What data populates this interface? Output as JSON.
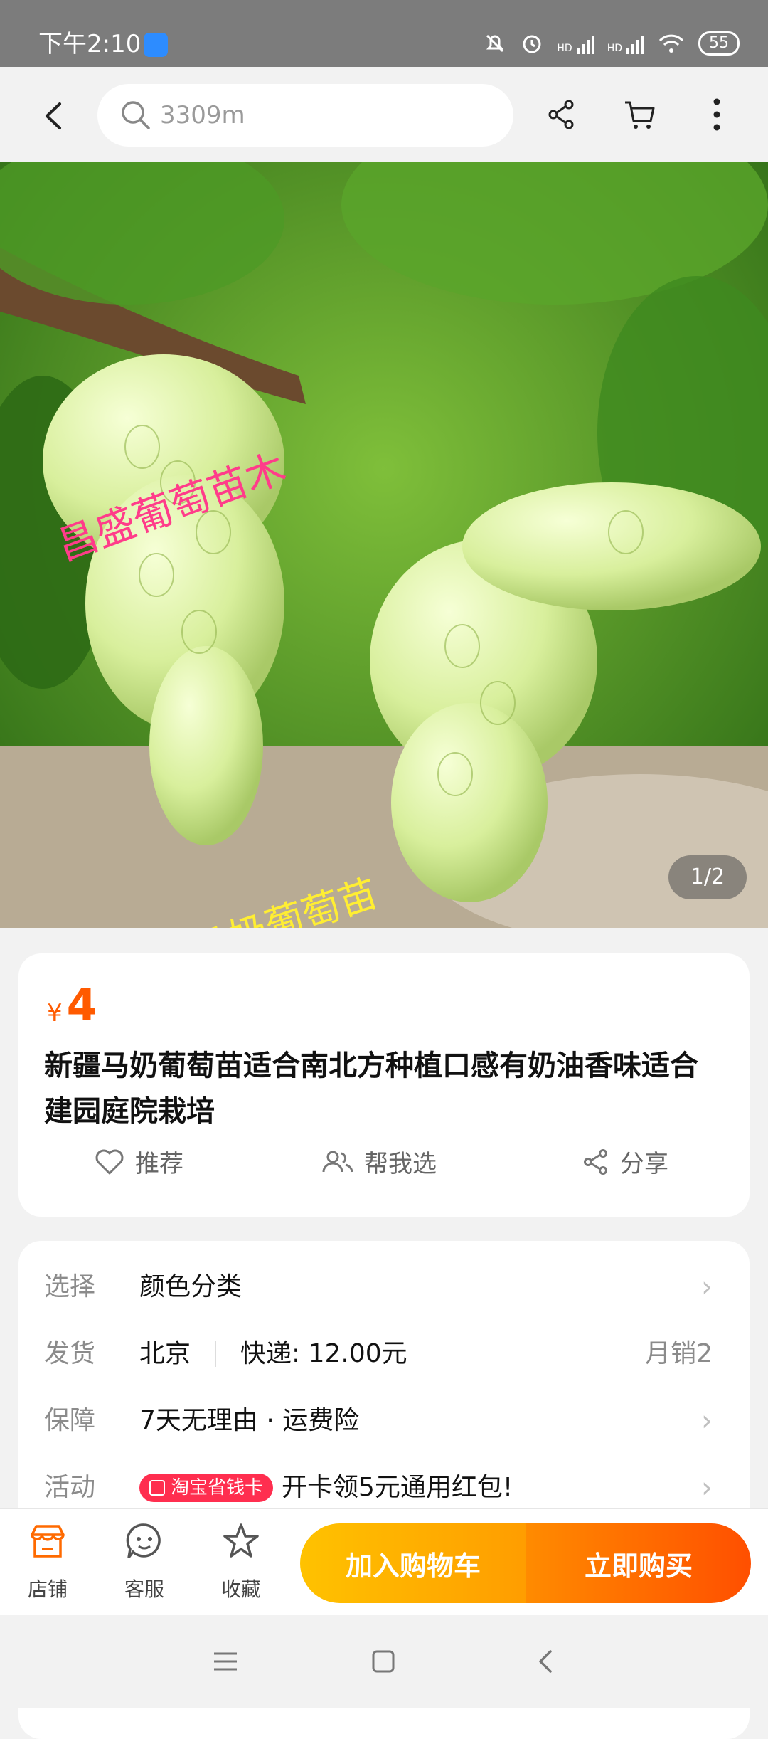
{
  "status_bar": {
    "time": "下午2:10",
    "network_labels": [
      "HD",
      "HD"
    ],
    "battery": "55"
  },
  "header": {
    "search_text": "3309m"
  },
  "hero": {
    "watermark_top": "昌盛葡萄苗木",
    "watermark_bottom": "新疆马奶葡萄苗",
    "page_indicator": "1/2"
  },
  "product": {
    "currency": "¥",
    "price": "4",
    "title": "新疆马奶葡萄苗适合南北方种植口感有奶油香味适合建园庭院栽培",
    "actions": {
      "recommend": "推荐",
      "help_choose": "帮我选",
      "share": "分享"
    }
  },
  "details": {
    "select": {
      "label": "选择",
      "value": "颜色分类"
    },
    "ship": {
      "label": "发货",
      "from": "北京",
      "express": "快递: 12.00元",
      "monthly_sales": "月销2"
    },
    "guarantee": {
      "label": "保障",
      "value": "7天无理由 · 运费险"
    },
    "promo": {
      "label": "活动",
      "tag": "淘宝省钱卡",
      "value": "开卡领5元通用红包!"
    }
  },
  "bottom_bar": {
    "shop": "店铺",
    "service": "客服",
    "favorite": "收藏",
    "add_to_cart": "加入购物车",
    "buy_now": "立即购买"
  },
  "colors": {
    "accent_orange": "#ff5a00",
    "cart_yellow": "#ffc200",
    "tag_red": "#ff2e4f"
  }
}
